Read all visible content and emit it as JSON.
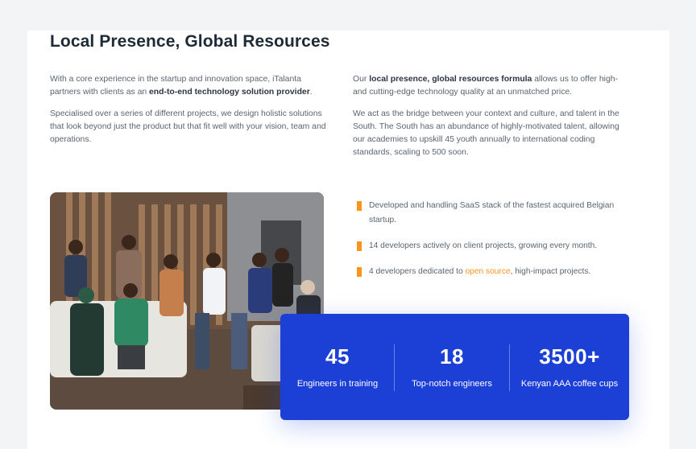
{
  "section": {
    "title": "Local Presence, Global Resources",
    "left": {
      "p1_text": "With a core experience in the startup and innovation space, iTalanta partners with clients as an ",
      "p1_bold": "end-to-end technology solution provider",
      "p1_end": ".",
      "p2": "Specialised over a series of different projects, we design holistic solutions that look beyond just the product but that fit well with your vision, team and operations."
    },
    "right": {
      "p1_start": "Our ",
      "p1_bold": "local presence, global resources formula",
      "p1_end": " allows us to offer high- and cutting-edge technology quality at an unmatched price.",
      "p2": "We act as the bridge between your context and culture, and talent in the South. The South has an abundance of highly-motivated talent, allowing our academies to upskill 45 youth annually to international coding standards, scaling to 500 soon."
    }
  },
  "bullets": {
    "b1": "Developed and handling SaaS stack of the fastest acquired Belgian startup.",
    "b2": "14 developers actively on client projects, growing every month.",
    "b3_start": "4 developers dedicated to ",
    "b3_link": "open source",
    "b3_end": ", high-impact projects."
  },
  "stats": [
    {
      "value": "45",
      "label": "Engineers in training"
    },
    {
      "value": "18",
      "label": "Top-notch engineers"
    },
    {
      "value": "3500+",
      "label": "Kenyan AAA coffee cups"
    }
  ],
  "colors": {
    "accent": "#f7941d",
    "stats_bg": "#1c3fd6",
    "title": "#1f2a37"
  },
  "photo": {
    "icon": "team-photo"
  }
}
